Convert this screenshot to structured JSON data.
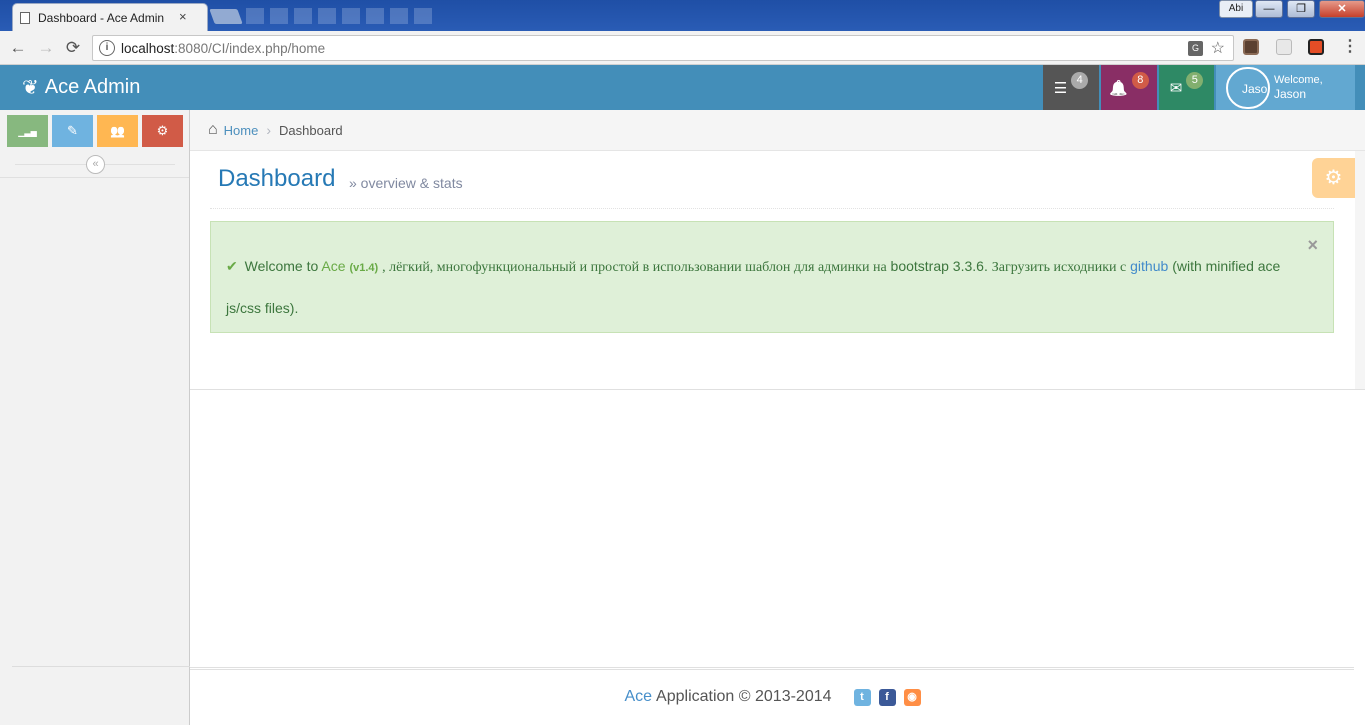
{
  "browser": {
    "tab_title": "Dashboard - Ace Admin",
    "tab_close": "×",
    "lang_button": "Abi",
    "url_host": "localhost",
    "url_path": ":8080/CI/index.php/home",
    "window_buttons": {
      "minimize": "—",
      "maximize": "❐",
      "close": "✕"
    },
    "nav": {
      "back": "←",
      "forward": "→",
      "reload": "⟳"
    },
    "icons": {
      "info": "i",
      "translate": "G",
      "star": "☆",
      "menu": "⋮"
    }
  },
  "navbar": {
    "brand": "Ace Admin",
    "brand_icon": "❦",
    "tasks_icon": "☰",
    "tasks_count": "4",
    "notifications_icon": "🔔",
    "notifications_count": "8",
    "messages_icon": "✉",
    "messages_count": "5",
    "avatar_alt": "Jaso",
    "welcome": "Welcome,",
    "user_name": "Jason"
  },
  "sidebar": {
    "shortcuts": [
      {
        "name": "signal",
        "icon": "▁▃▅"
      },
      {
        "name": "pencil",
        "icon": "✎"
      },
      {
        "name": "users",
        "icon": "👥"
      },
      {
        "name": "cogs",
        "icon": "⚙"
      }
    ],
    "collapse_icon": "«"
  },
  "breadcrumb": {
    "home_icon": "⌂",
    "home": "Home",
    "separator": "›",
    "current": "Dashboard"
  },
  "page": {
    "title": "Dashboard",
    "subtitle": "» overview & stats",
    "settings_icon": "⚙"
  },
  "alert": {
    "check_icon": "✔",
    "welcome_to": "Welcome to",
    "ace": "Ace",
    "version": "(v1.4)",
    "text_ru_1": ", лёгкий, многофункциональный и простой в использовании шаблон для админки на",
    "bootstrap": "bootstrap 3.3.6.",
    "text_ru_2": "Загрузить исходники с",
    "github": "github",
    "text_end": "(with minified ace js/css files).",
    "close": "×"
  },
  "footer": {
    "ace": "Ace",
    "text": "Application © 2013-2014",
    "social": {
      "twitter": "t",
      "facebook": "f",
      "rss": "◉"
    }
  }
}
